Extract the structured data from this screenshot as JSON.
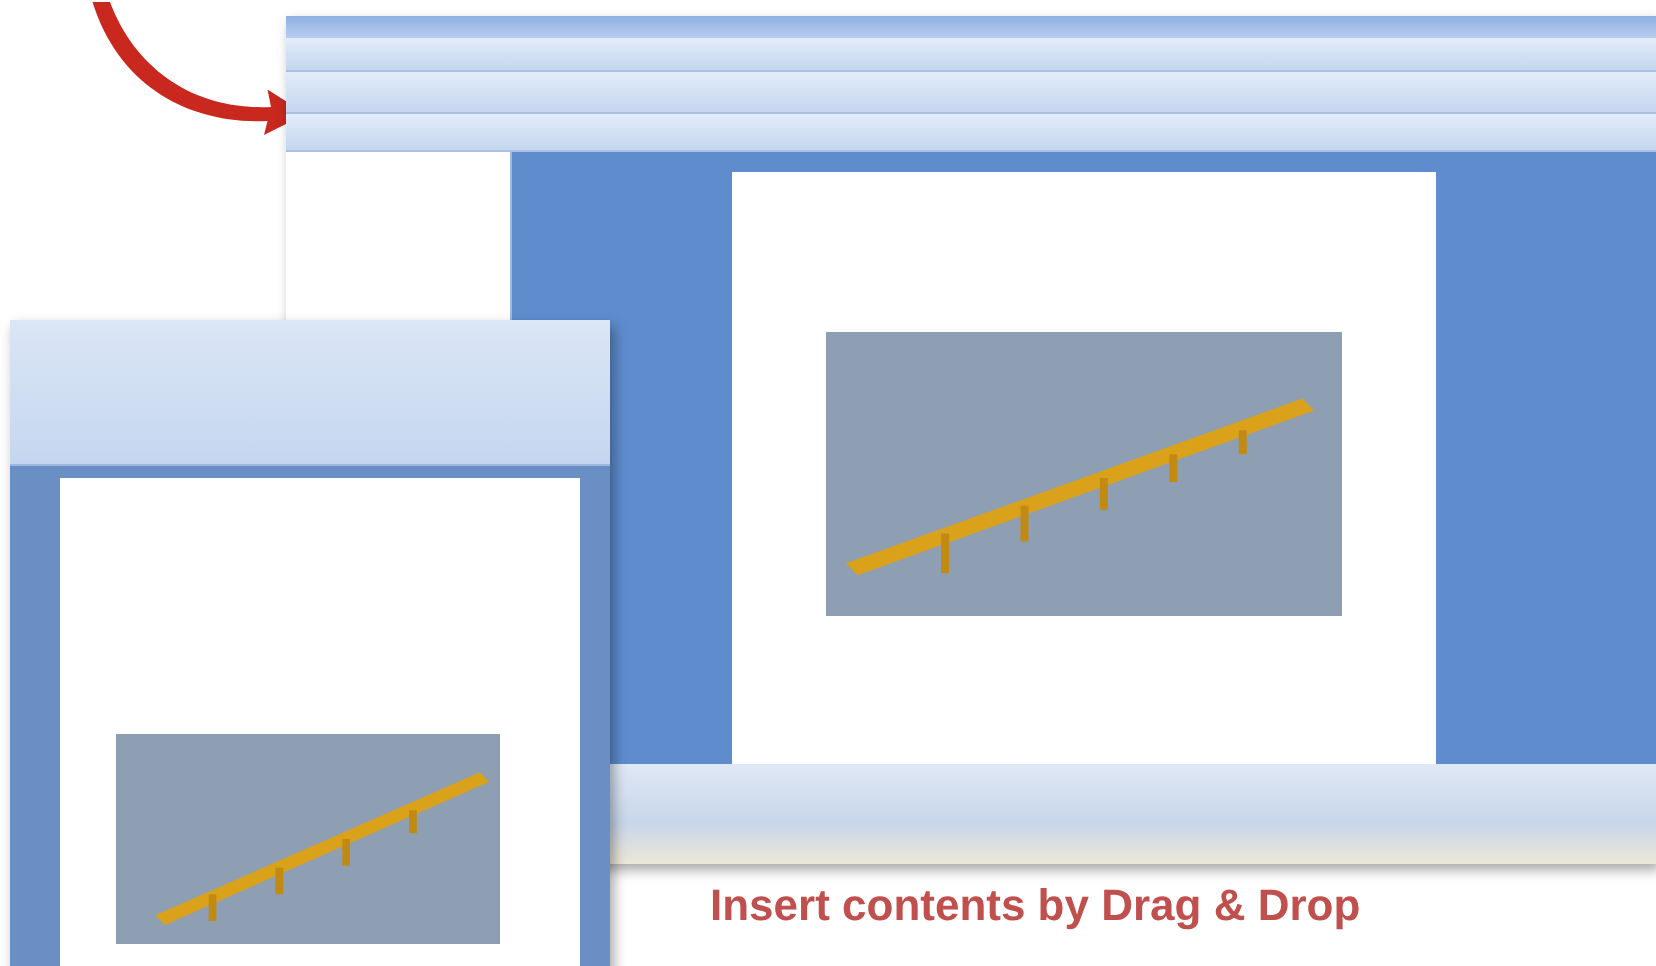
{
  "caption": "Insert contents by Drag & Drop"
}
